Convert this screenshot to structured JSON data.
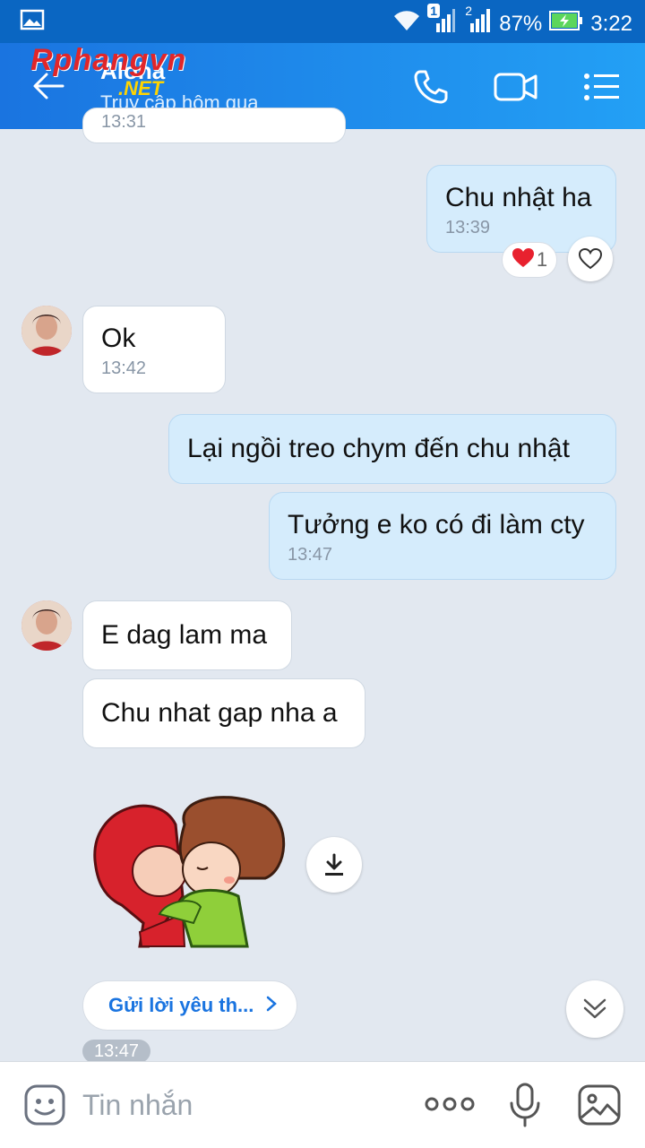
{
  "status_bar": {
    "battery": "87%",
    "time": "3:22",
    "sim1_badge": "1",
    "sim2_badge": "2"
  },
  "header": {
    "contact_name": "Aloha",
    "status": "Truy cập hôm qua",
    "watermark_main": "Rphangvn",
    "watermark_sub": ".NET"
  },
  "messages": [
    {
      "side": "them",
      "text": "",
      "time": "13:31"
    },
    {
      "side": "me",
      "text": "Chu nhật ha",
      "time": "13:39",
      "reaction_count": "1"
    },
    {
      "side": "them",
      "text": "Ok",
      "time": "13:42"
    },
    {
      "side": "me",
      "text": "Lại ngồi treo chym đến chu nhật",
      "time": ""
    },
    {
      "side": "me",
      "text": "Tưởng e ko có đi làm cty",
      "time": "13:47"
    },
    {
      "side": "them",
      "text": "E dag lam ma",
      "time": ""
    },
    {
      "side": "them",
      "text": "Chu nhat gap nha a",
      "time": ""
    }
  ],
  "sticker": {
    "suggestion_label": "Gửi lời yêu th...",
    "time": "13:47"
  },
  "composer": {
    "placeholder": "Tin nhắn"
  },
  "colors": {
    "header": "#1a74e0",
    "my_bubble": "#d5ecfc",
    "background": "#e2e8f0"
  }
}
